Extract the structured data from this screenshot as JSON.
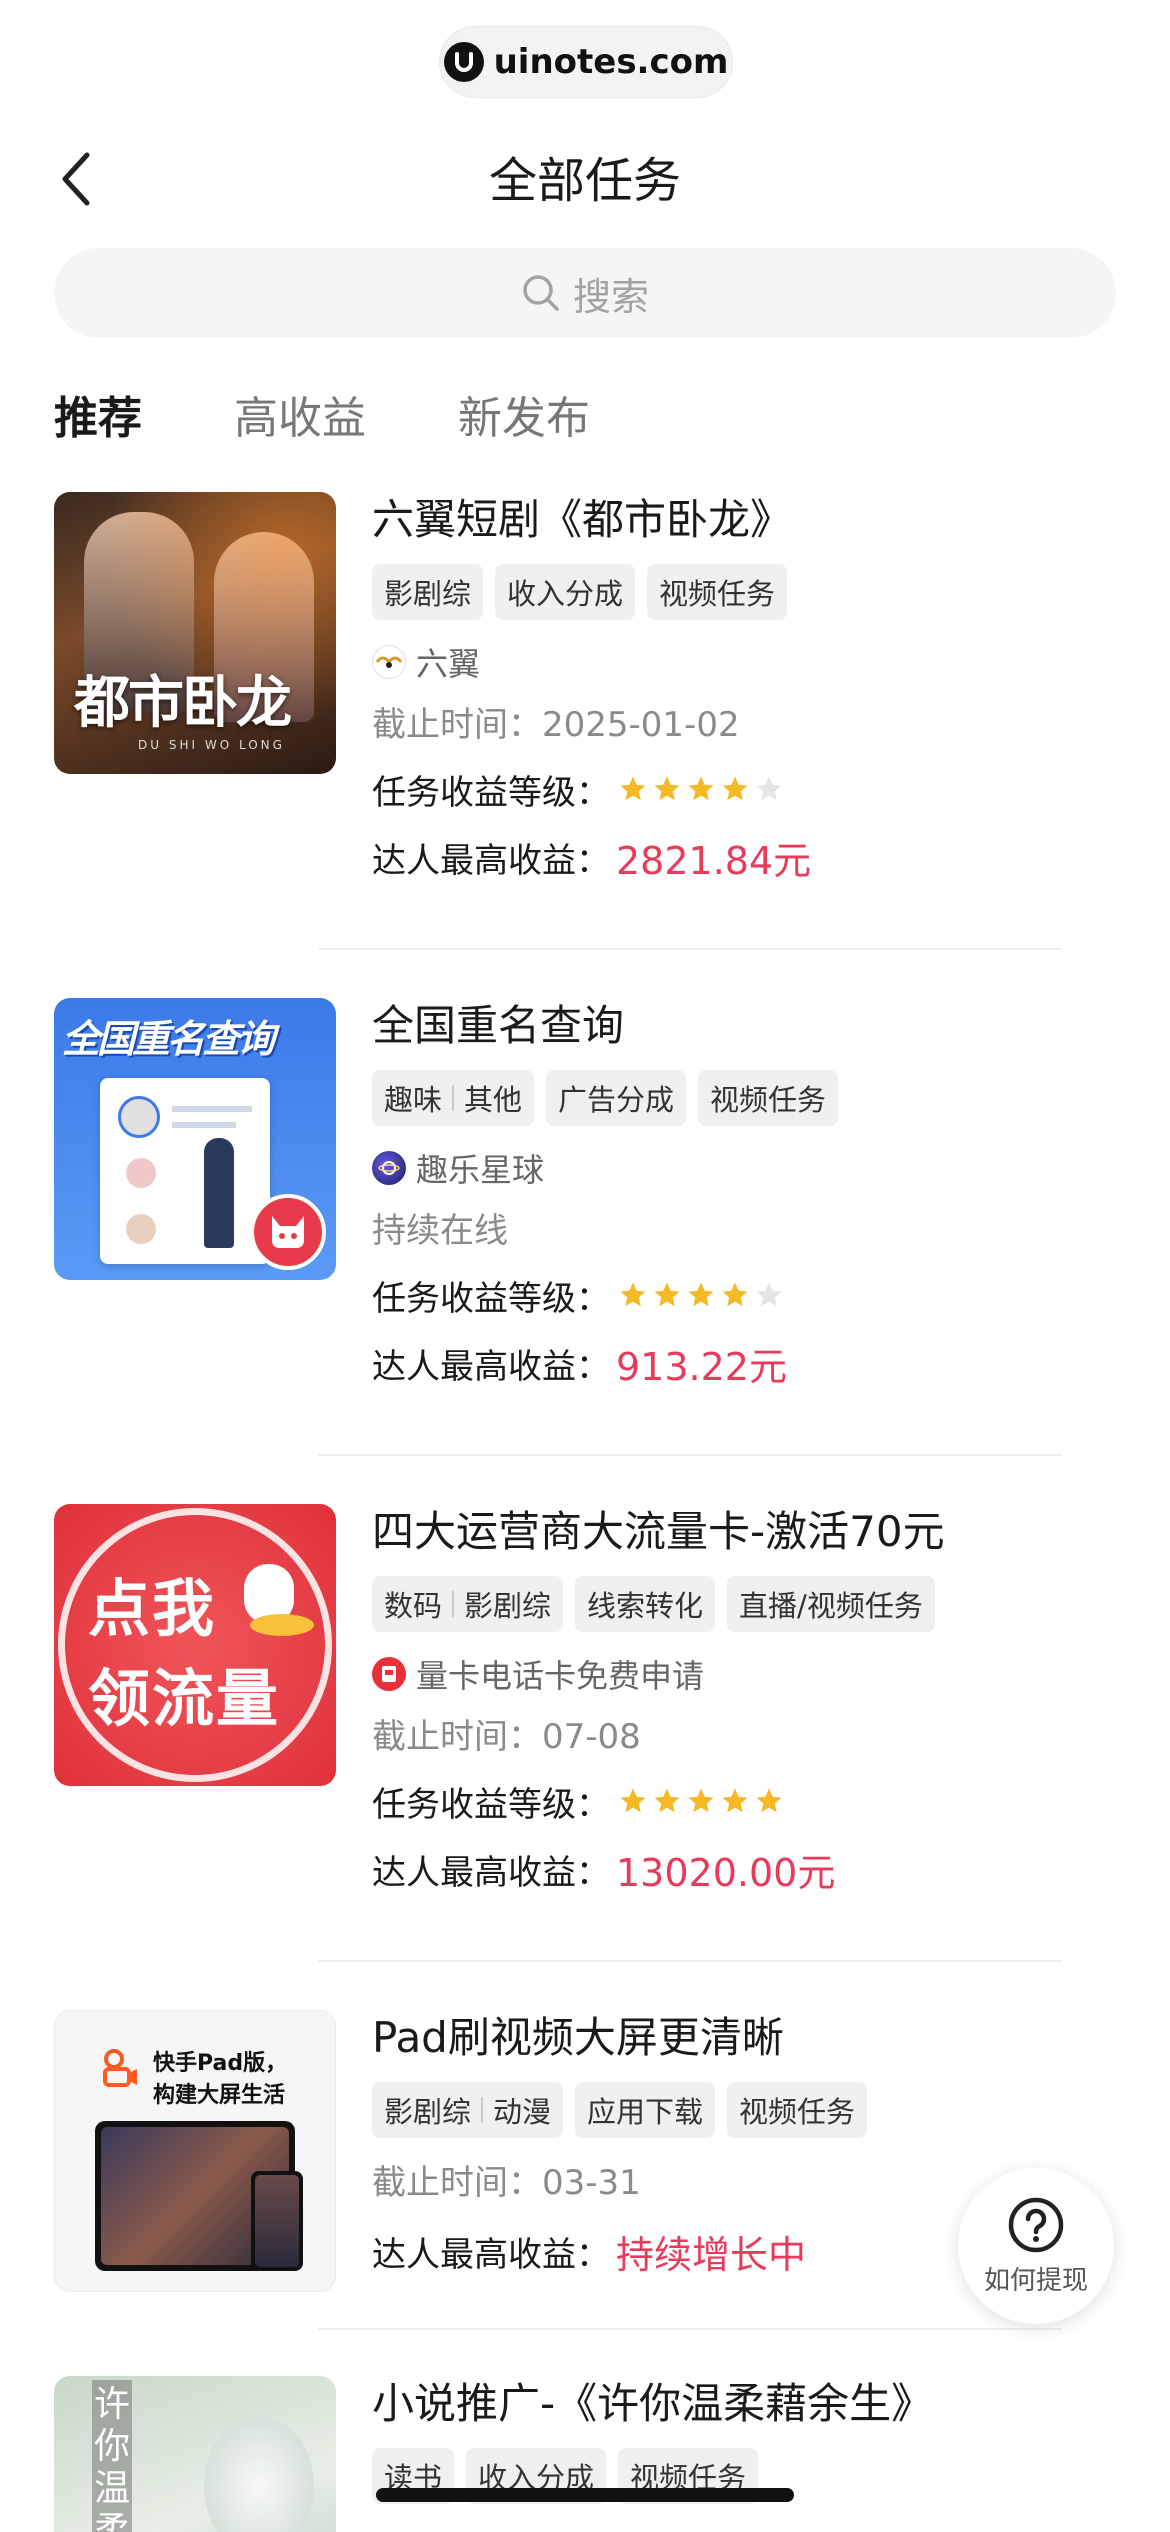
{
  "watermark": {
    "text": "uinotes.com"
  },
  "header": {
    "title": "全部任务"
  },
  "search": {
    "placeholder": "搜索"
  },
  "tabs": [
    {
      "label": "推荐",
      "active": true
    },
    {
      "label": "高收益",
      "active": false
    },
    {
      "label": "新发布",
      "active": false
    }
  ],
  "labels": {
    "level": "任务收益等级：",
    "earnings": "达人最高收益：",
    "help": "如何提现"
  },
  "tasks": [
    {
      "title": "六翼短剧《都市卧龙》",
      "tags": [
        [
          "影剧综"
        ],
        [
          "收入分成"
        ],
        [
          "视频任务"
        ]
      ],
      "publisher": "六翼",
      "meta": "截止时间：2025-01-02",
      "stars": 4,
      "earnings": "2821.84元",
      "thumb_text": "都市卧龙",
      "thumb_sub": "DU SHI WO LONG"
    },
    {
      "title": "全国重名查询",
      "tags": [
        [
          "趣味",
          "其他"
        ],
        [
          "广告分成"
        ],
        [
          "视频任务"
        ]
      ],
      "publisher": "趣乐星球",
      "meta": "持续在线",
      "stars": 4,
      "earnings": "913.22元",
      "thumb_text": "全国重名查询"
    },
    {
      "title": "四大运营商大流量卡-激活70元",
      "tags": [
        [
          "数码",
          "影剧综"
        ],
        [
          "线索转化"
        ],
        [
          "直播/视频任务"
        ]
      ],
      "publisher": "量卡电话卡免费申请",
      "meta": "截止时间：07-08",
      "stars": 5,
      "earnings": "13020.00元",
      "thumb_line1": "点我",
      "thumb_line2": "领流量"
    },
    {
      "title": "Pad刷视频大屏更清晰",
      "tags": [
        [
          "影剧综",
          "动漫"
        ],
        [
          "应用下载"
        ],
        [
          "视频任务"
        ]
      ],
      "meta": "截止时间：03-31",
      "earnings": "持续增长中",
      "thumb_line1": "快手Pad版，",
      "thumb_line2": "构建大屏生活"
    },
    {
      "title": "小说推广-《许你温柔藉余生》",
      "tags": [
        [
          "读书"
        ],
        [
          "收入分成"
        ],
        [
          "视频任务"
        ]
      ],
      "thumb_text": "许你温柔"
    }
  ],
  "colors": {
    "accent": "#e83a5a",
    "star": "#f5b925",
    "star_empty": "#e5e5e5"
  }
}
